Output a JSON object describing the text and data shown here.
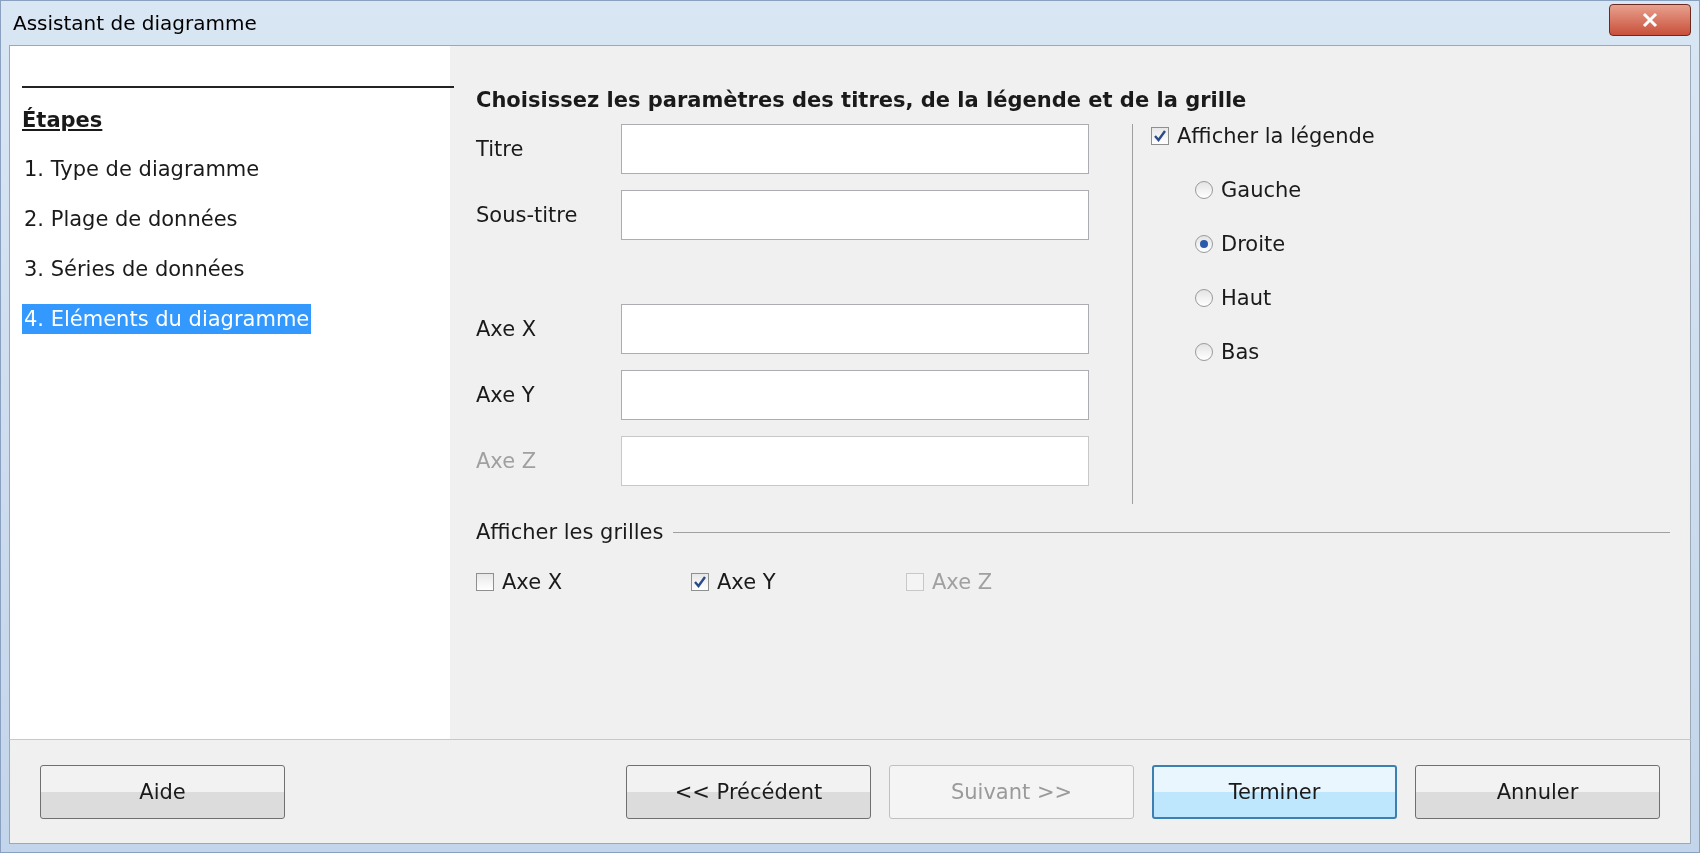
{
  "window": {
    "title": "Assistant de diagramme"
  },
  "steps": {
    "heading": "Étapes",
    "items": [
      {
        "label": "1. Type de diagramme",
        "selected": false
      },
      {
        "label": "2. Plage de données",
        "selected": false
      },
      {
        "label": "3. Séries de données",
        "selected": false
      },
      {
        "label": "4. Eléments du diagramme",
        "selected": true
      }
    ]
  },
  "heading": "Choisissez les paramètres des titres, de la légende et de la grille",
  "titles": [
    {
      "label": "Titre",
      "disabled": false
    },
    {
      "label": "Sous-titre",
      "disabled": false
    }
  ],
  "axes": [
    {
      "label": "Axe X",
      "disabled": false
    },
    {
      "label": "Axe Y",
      "disabled": false
    },
    {
      "label": "Axe Z",
      "disabled": true
    }
  ],
  "legend": {
    "label": "Afficher la légende",
    "checked": true,
    "positions": [
      {
        "label": "Gauche",
        "selected": false
      },
      {
        "label": "Droite",
        "selected": true
      },
      {
        "label": "Haut",
        "selected": false
      },
      {
        "label": "Bas",
        "selected": false
      }
    ]
  },
  "grids": {
    "label": "Afficher les grilles",
    "items": [
      {
        "label": "Axe X",
        "checked": false,
        "disabled": false
      },
      {
        "label": "Axe Y",
        "checked": true,
        "disabled": false
      },
      {
        "label": "Axe Z",
        "checked": false,
        "disabled": true
      }
    ]
  },
  "help_button": {
    "label": "Aide",
    "disabled": false
  },
  "nav_buttons": [
    {
      "label": "<< Précédent",
      "disabled": false,
      "default": false
    },
    {
      "label": "Suivant >>",
      "disabled": true,
      "default": false
    },
    {
      "label": "Terminer",
      "disabled": false,
      "default": true
    },
    {
      "label": "Annuler",
      "disabled": false,
      "default": false
    }
  ]
}
